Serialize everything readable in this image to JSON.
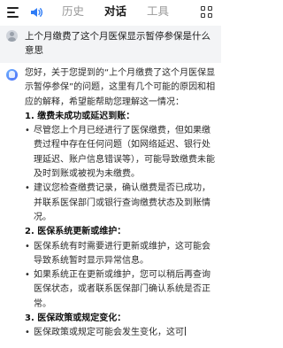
{
  "header": {
    "tabs": [
      {
        "label": "历史",
        "active": false
      },
      {
        "label": "对话",
        "active": true
      },
      {
        "label": "工具",
        "active": false
      }
    ],
    "icons": {
      "menu": "menu-icon",
      "speaker": "speaker-icon",
      "more": "grid-icon"
    },
    "accent_color": "#2f7cf6"
  },
  "question": {
    "text": "上个月缴费了这个月医保显示暂停参保是什么意思"
  },
  "answer": {
    "intro": "您好，关于您提到的“上个月缴费了这个月医保显示暂停参保”的问题，这里有几个可能的原因和相应的解释，希望能帮助您理解这一情况：",
    "sections": [
      {
        "heading": "1. 缴费未成功或延迟到账：",
        "bullets": [
          "尽管您上个月已经进行了医保缴费，但如果缴费过程中存在任何问题（如网络延迟、银行处理延迟、账户信息错误等），可能导致缴费未能及时到账或被视为未缴费。",
          "建议您检查缴费记录，确认缴费是否已成功，并联系医保部门或银行查询缴费状态及到账情况。"
        ]
      },
      {
        "heading": "2. 医保系统更新或维护：",
        "bullets": [
          "医保系统有时需要进行更新或维护，这可能会导致系统暂时显示异常信息。",
          "如果系统正在更新或维护，您可以稍后再查询医保状态，或者联系医保部门确认系统是否正常。"
        ]
      },
      {
        "heading": "3. 医保政策或规定变化：",
        "bullets": [
          "医保政策或规定可能会发生变化，这可"
        ]
      }
    ]
  }
}
